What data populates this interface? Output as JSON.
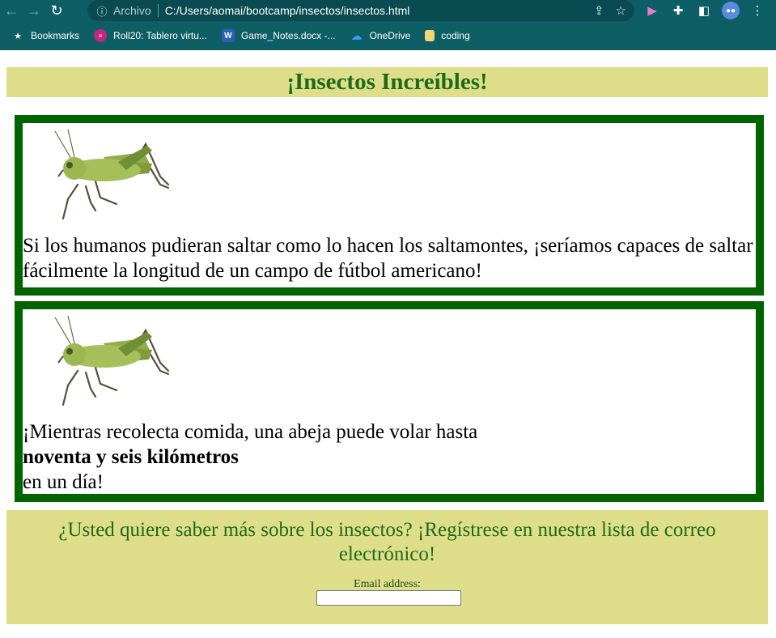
{
  "browser": {
    "address_scheme_label": "Archivo",
    "url": "C:/Users/aomai/bootcamp/insectos/insectos.html",
    "bookmarks": [
      {
        "label": "Bookmarks",
        "icon": "star-icon"
      },
      {
        "label": "Roll20: Tablero virtu...",
        "icon": "roll20-icon"
      },
      {
        "label": "Game_Notes.docx -...",
        "icon": "word-icon"
      },
      {
        "label": "OneDrive",
        "icon": "onedrive-icon"
      },
      {
        "label": "coding",
        "icon": "folder-icon"
      }
    ]
  },
  "page": {
    "title": "¡Insectos Increíbles!",
    "facts": [
      {
        "image": "grasshopper-image",
        "text": "Si los humanos pudieran saltar como lo hacen los saltamontes, ¡seríamos capaces de saltar fácilmente la longitud de un campo de fútbol americano!"
      },
      {
        "image": "grasshopper-image",
        "text_before": "¡Mientras recolecta comida, una abeja puede volar hasta",
        "text_bold": "noventa y seis kilómetros",
        "text_after": "en un día!"
      }
    ],
    "signup": {
      "text": "¿Usted quiere saber más sobre los insectos? ¡Regístrese en nuestra lista de correo electrónico!",
      "email_label": "Email address:",
      "email_value": ""
    }
  },
  "colors": {
    "chrome": "#0e5e66",
    "banner_bg": "#dede8a",
    "banner_text": "#1f6a1a",
    "card_border": "#006400"
  }
}
